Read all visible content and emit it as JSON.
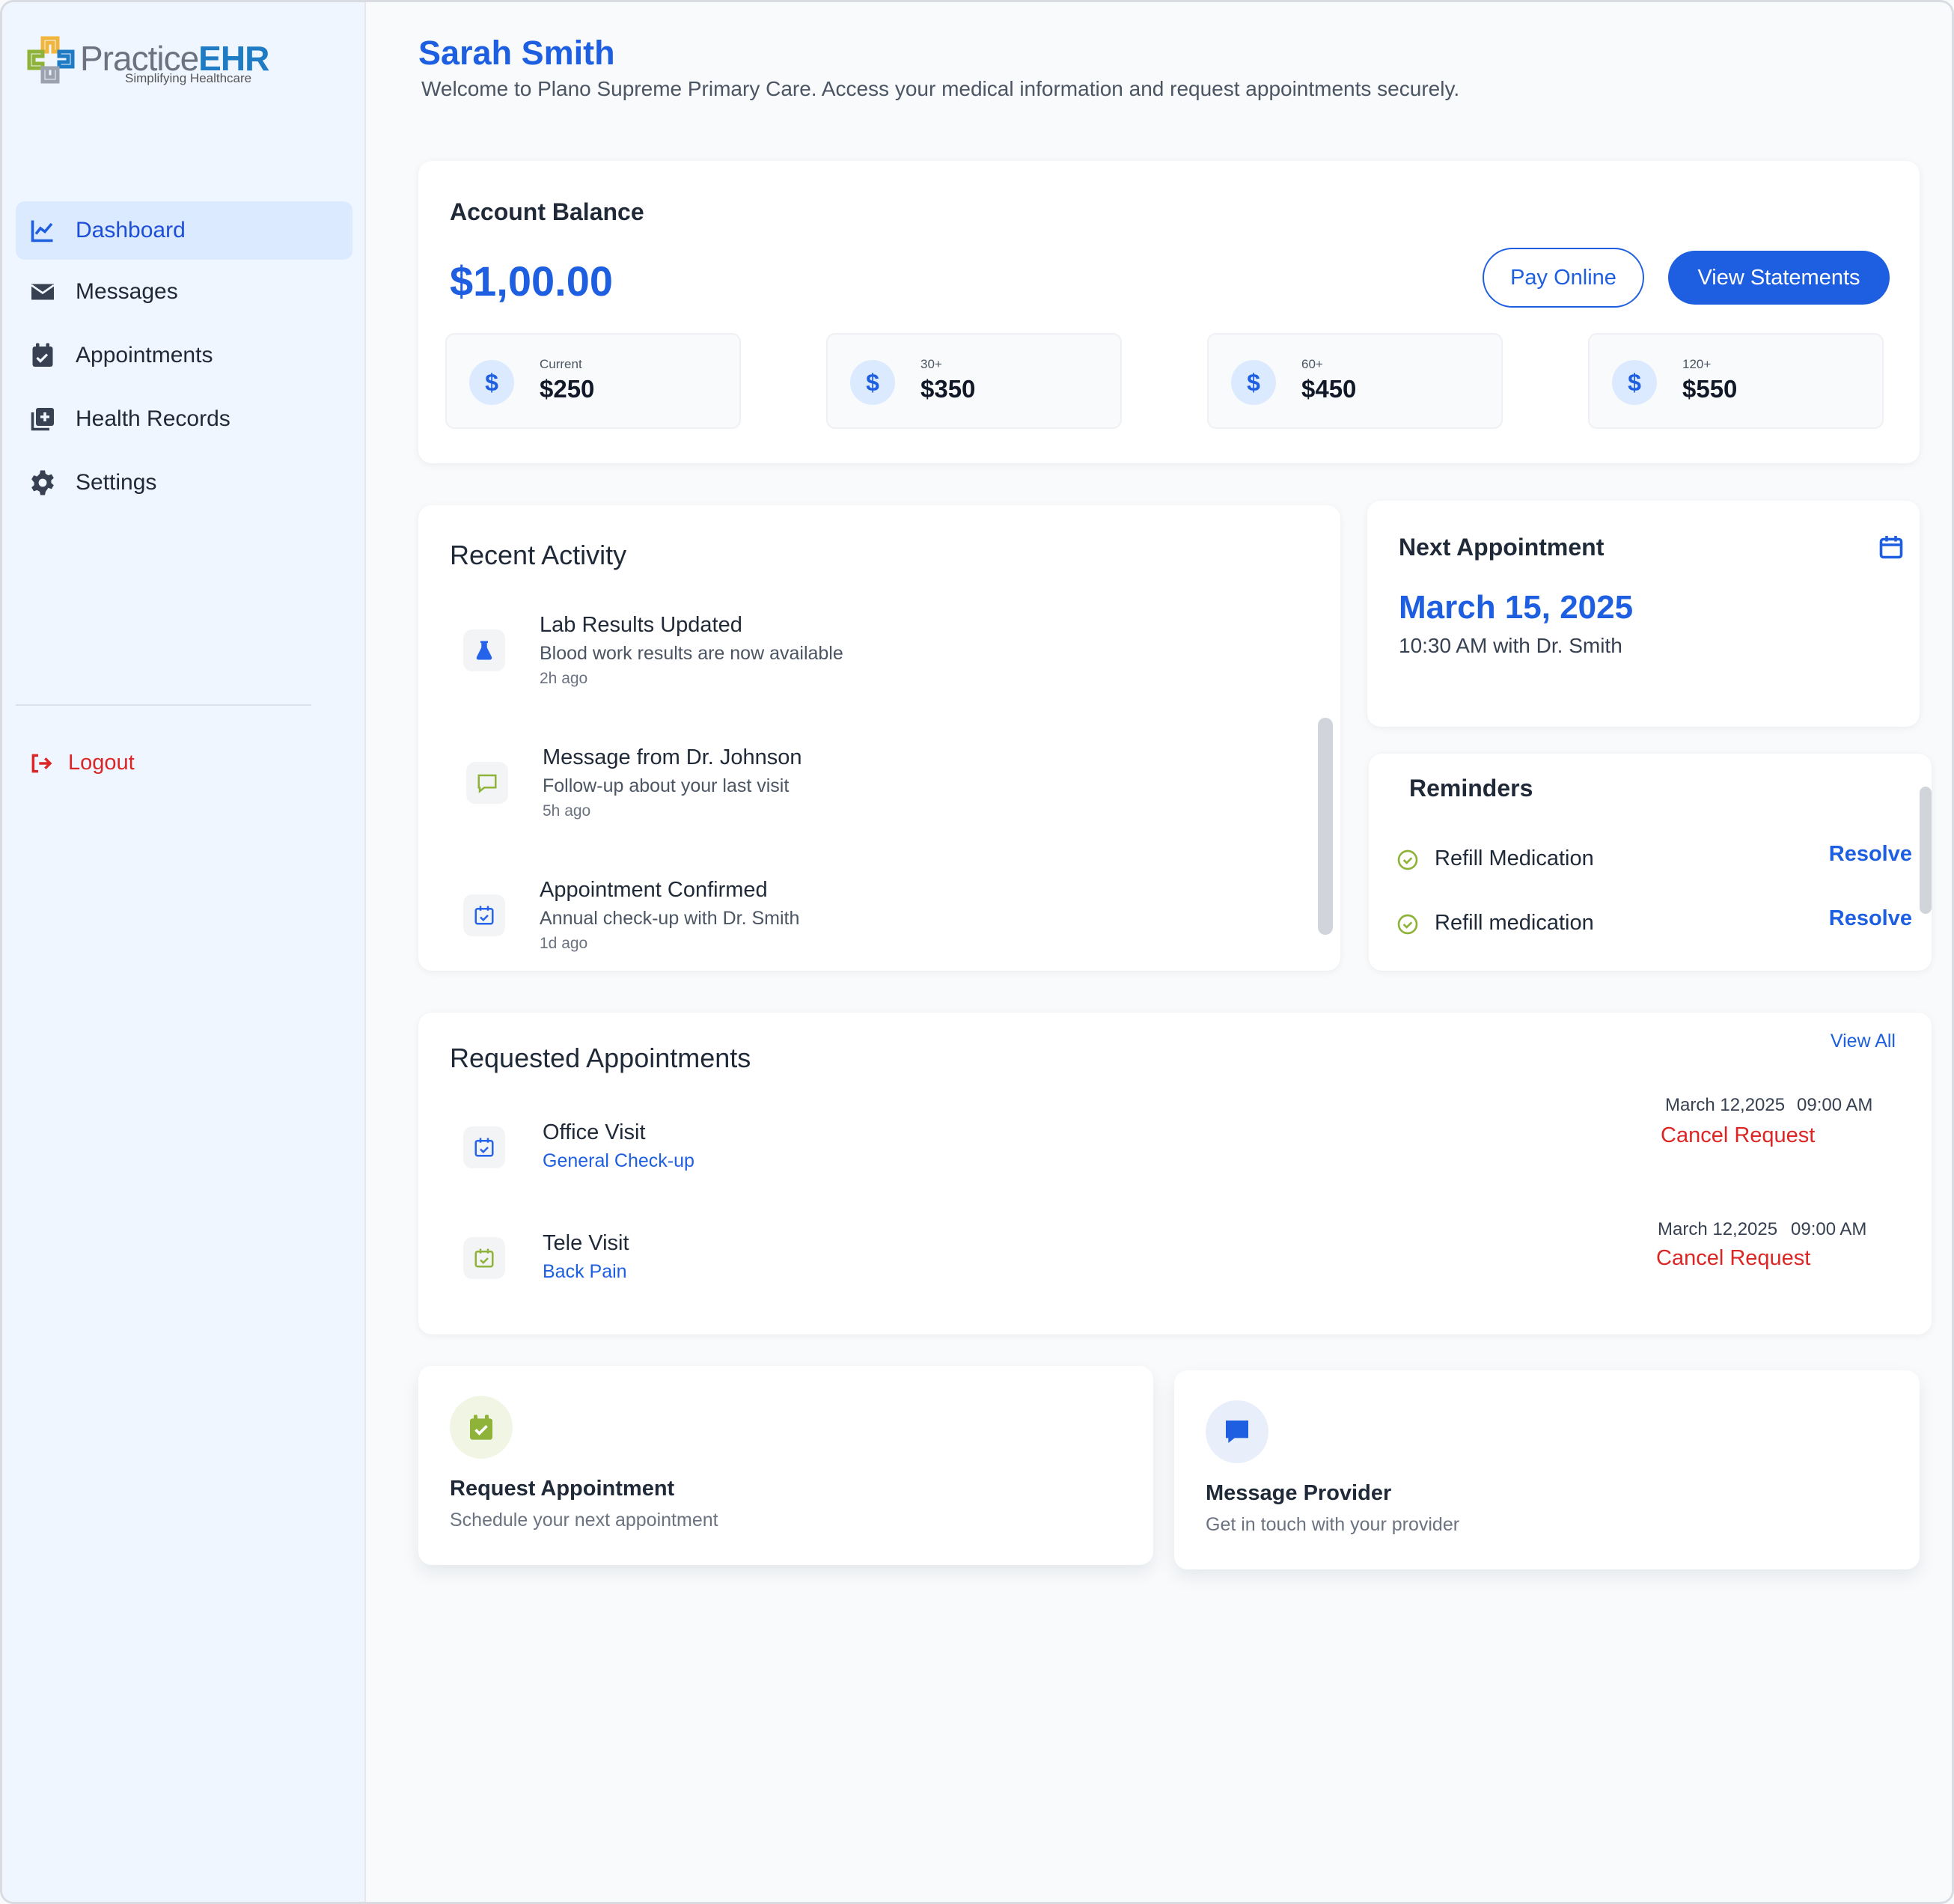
{
  "brand": {
    "name_part1": "Practice",
    "name_part2": "EHR",
    "tagline": "Simplifying Healthcare"
  },
  "sidebar": {
    "items": [
      {
        "label": "Dashboard",
        "icon": "chart-line-icon",
        "active": true
      },
      {
        "label": "Messages",
        "icon": "envelope-icon"
      },
      {
        "label": "Appointments",
        "icon": "calendar-check-icon"
      },
      {
        "label": "Health Records",
        "icon": "medical-folder-icon"
      },
      {
        "label": "Settings",
        "icon": "gear-icon"
      }
    ],
    "logout_label": "Logout"
  },
  "header": {
    "name": "Sarah Smith",
    "welcome": "Welcome to Plano Supreme Primary Care. Access your medical information and request appointments securely."
  },
  "balance": {
    "title": "Account Balance",
    "amount": "$1,00.00",
    "pay_label": "Pay Online",
    "statements_label": "View Statements",
    "aging": [
      {
        "label": "Current",
        "value": "$250"
      },
      {
        "label": "30+",
        "value": "$350"
      },
      {
        "label": "60+",
        "value": "$450"
      },
      {
        "label": "120+",
        "value": "$550"
      }
    ]
  },
  "activity": {
    "title": "Recent Activity",
    "items": [
      {
        "title": "Lab Results Updated",
        "desc": "Blood work results are now available",
        "time": "2h ago",
        "icon": "flask-icon"
      },
      {
        "title": "Message from Dr. Johnson",
        "desc": "Follow-up about your last visit",
        "time": "5h ago",
        "icon": "chat-bubble-icon"
      },
      {
        "title": "Appointment Confirmed",
        "desc": "Annual check-up with Dr. Smith",
        "time": "1d ago",
        "icon": "calendar-check-icon"
      }
    ]
  },
  "next_appointment": {
    "title": "Next Appointment",
    "date": "March 15, 2025",
    "detail": "10:30 AM with Dr. Smith"
  },
  "reminders": {
    "title": "Reminders",
    "items": [
      {
        "text": "Refill Medication",
        "action": "Resolve"
      },
      {
        "text": "Refill medication",
        "action": "Resolve"
      }
    ]
  },
  "requested": {
    "title": "Requested Appointments",
    "view_all": "View All",
    "items": [
      {
        "type": "Office Visit",
        "reason": "General Check-up",
        "date": "March 12,2025",
        "time": "09:00 AM",
        "action": "Cancel Request"
      },
      {
        "type": "Tele Visit",
        "reason": "Back Pain",
        "date": "March 12,2025",
        "time": "09:00 AM",
        "action": "Cancel Request"
      }
    ]
  },
  "quick_actions": [
    {
      "title": "Request Appointment",
      "subtitle": "Schedule your next appointment"
    },
    {
      "title": "Message Provider",
      "subtitle": "Get in touch with your provider"
    }
  ],
  "colors": {
    "primary": "#1d5fe0",
    "danger": "#dc2626",
    "accent_green": "#8fb339",
    "sidebar_bg": "#eff6ff"
  }
}
